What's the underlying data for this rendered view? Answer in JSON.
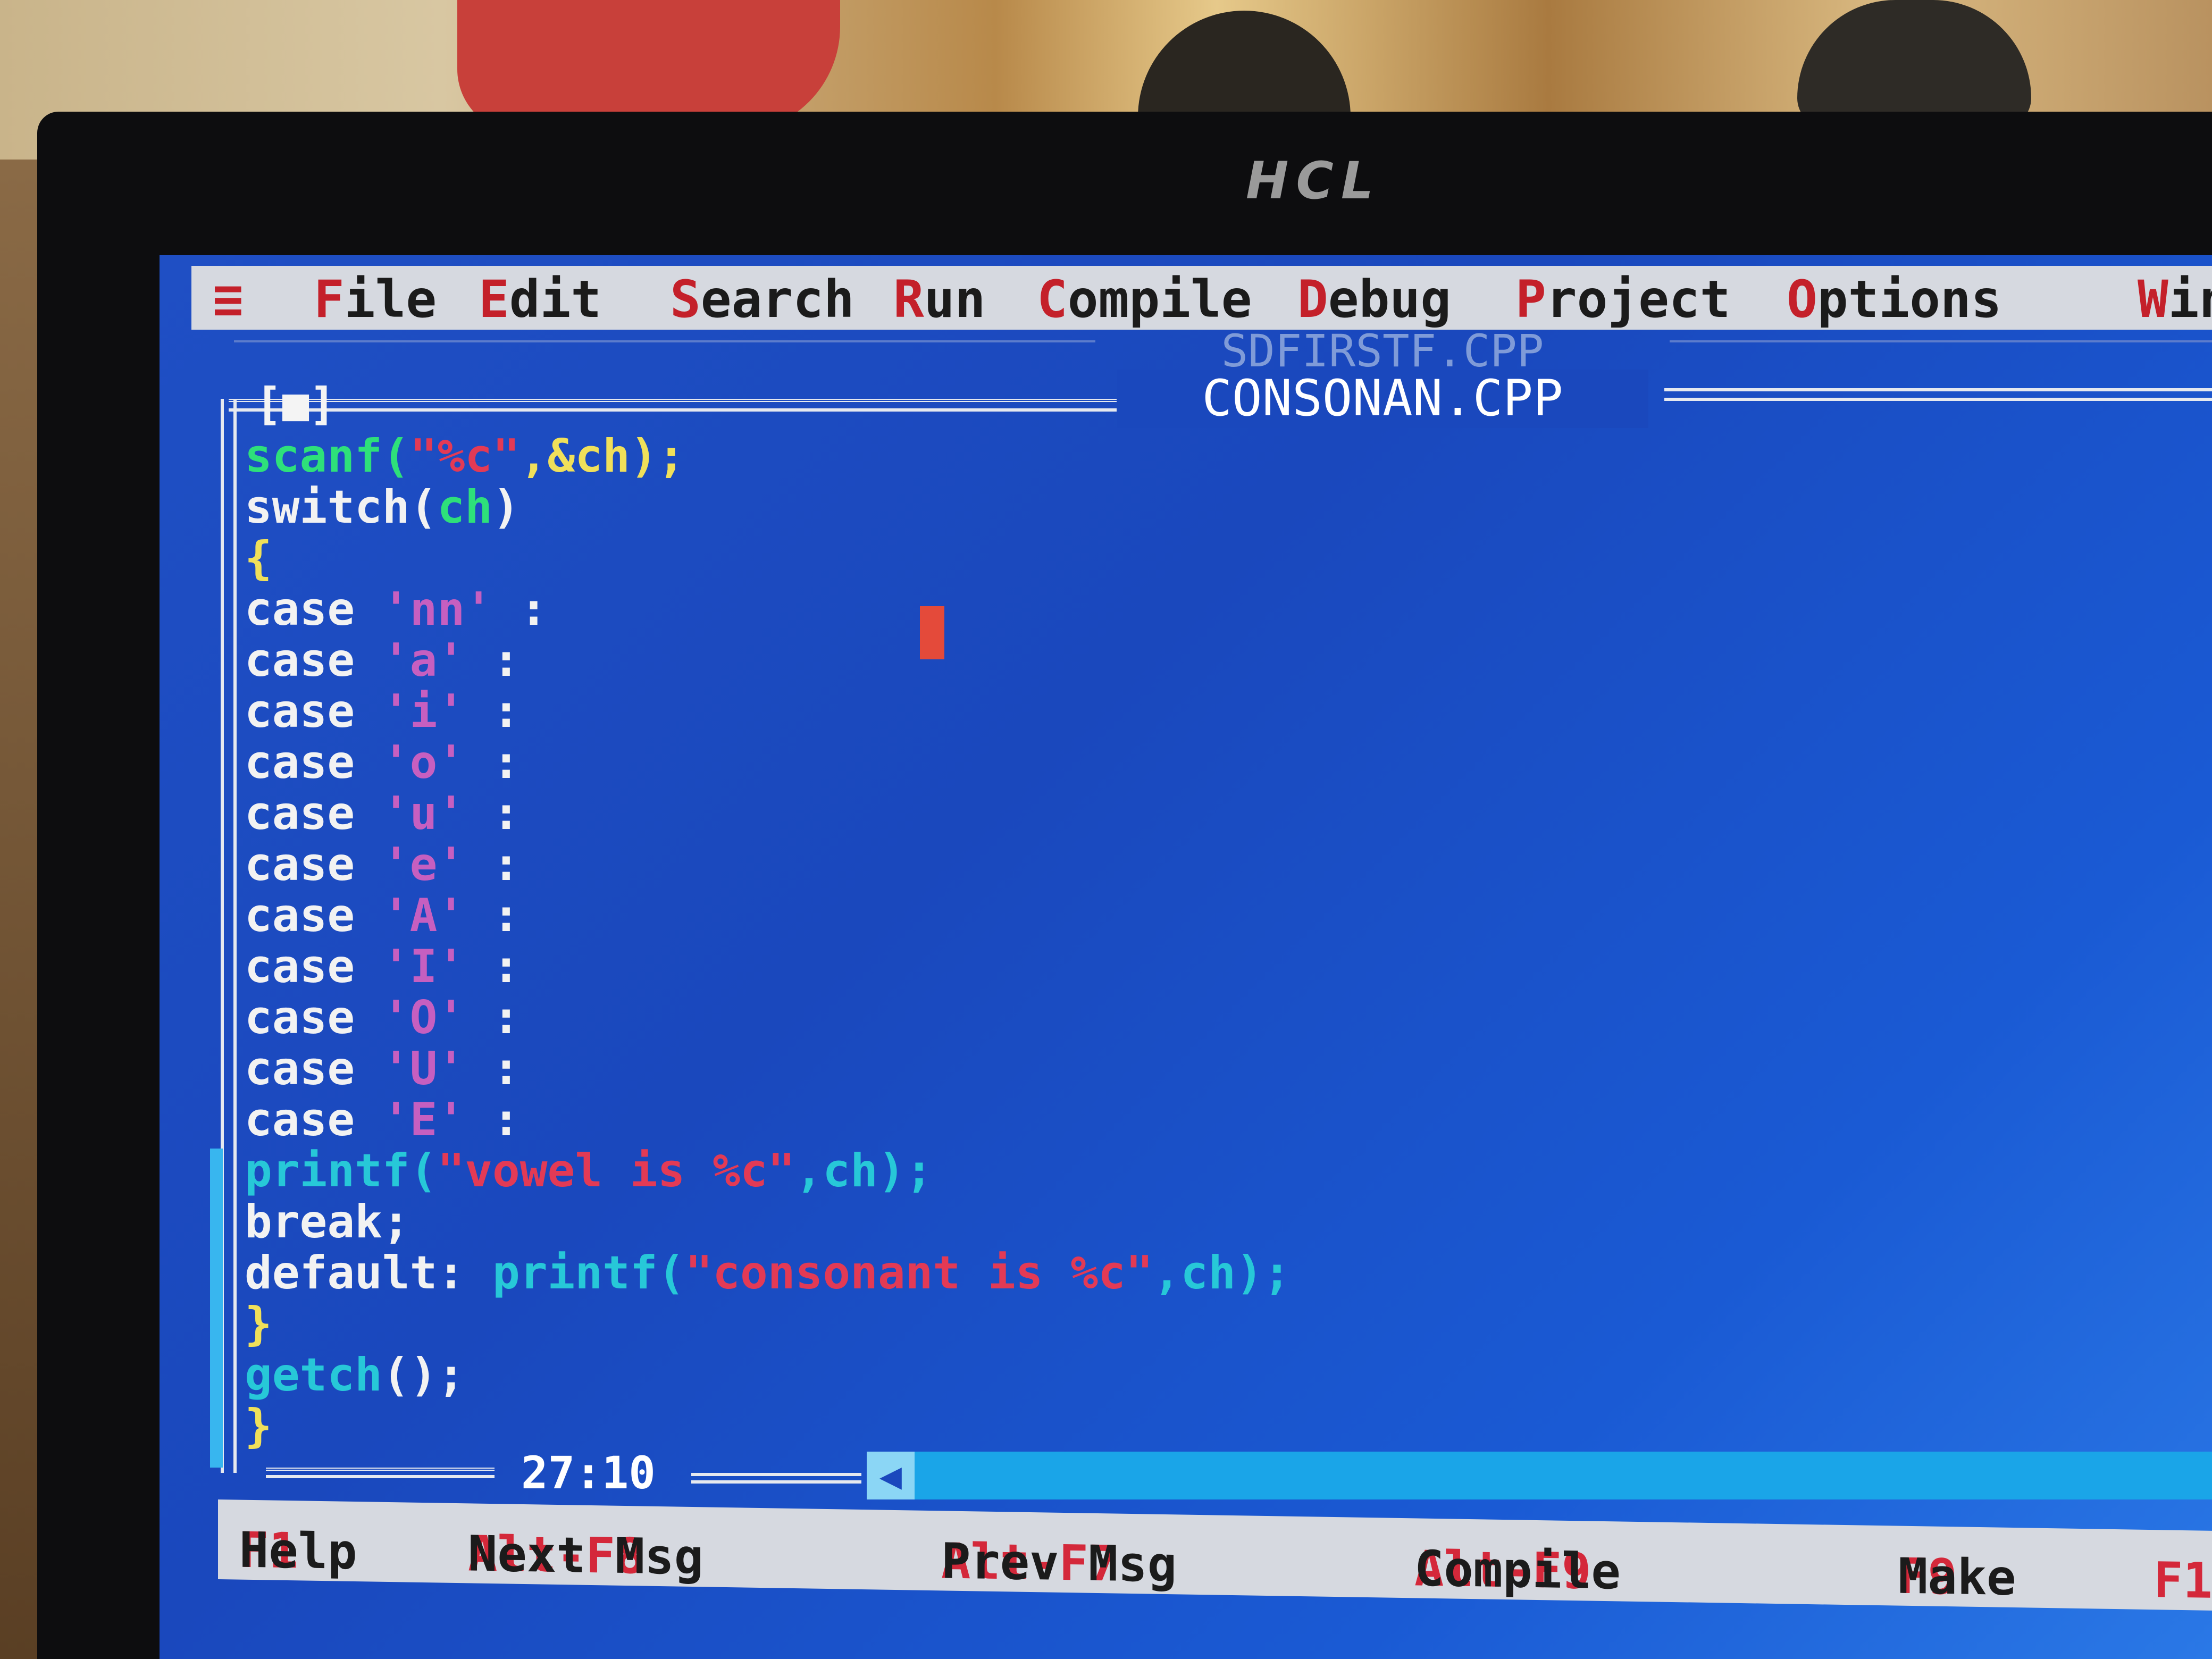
{
  "monitor": {
    "brand": "HCL"
  },
  "menu": {
    "system_icon": "≡",
    "items": [
      {
        "hotkey": "F",
        "rest": "ile"
      },
      {
        "hotkey": "E",
        "rest": "dit"
      },
      {
        "hotkey": "S",
        "rest": "earch"
      },
      {
        "hotkey": "R",
        "rest": "un"
      },
      {
        "hotkey": "C",
        "rest": "ompile"
      },
      {
        "hotkey": "D",
        "rest": "ebug"
      },
      {
        "hotkey": "P",
        "rest": "roject"
      },
      {
        "hotkey": "O",
        "rest": "ptions"
      },
      {
        "hotkey": "W",
        "rest": "in"
      }
    ]
  },
  "windows": {
    "background_file": "SDFIRSTF.CPP",
    "active_file": "CONSONAN.CPP",
    "close_box": "[■]"
  },
  "code": {
    "l1a": "scanf(",
    "l1b": "\"%c\"",
    "l1c": ",&ch);",
    "l2a": "switch(",
    "l2b": "ch",
    "l2c": ")",
    "l3": "{",
    "case_kw": "case",
    "cases": [
      "'nn'",
      "'a'",
      "'i'",
      "'o'",
      "'u'",
      "'e'",
      "'A'",
      "'I'",
      "'O'",
      "'U'",
      "'E'"
    ],
    "case_colon": " :",
    "p1a": "printf(",
    "p1b": "\"vowel is %c\"",
    "p1c": ",ch);",
    "brk": "break;",
    "defa": "default: ",
    "defb": "printf(",
    "defc": "\"consonant is %c\"",
    "defd": ",ch);",
    "close1": "}",
    "getcha": "getch",
    "getchb": "();",
    "close2": "}"
  },
  "status": {
    "cursor_position": "27:10"
  },
  "hints": [
    {
      "key": "F1",
      "label": "Help"
    },
    {
      "key": "Alt-F8",
      "label": "Next Msg"
    },
    {
      "key": "Alt-F7",
      "label": "Prev Msg"
    },
    {
      "key": "Alt-F9",
      "label": "Compile"
    },
    {
      "key": "F9",
      "label": "Make"
    },
    {
      "key": "F1",
      "label": ""
    }
  ],
  "colors": {
    "editor_bg": "#1a48bd",
    "menu_bg": "#d6d9e0",
    "hotkey": "#c4202a",
    "keyword": "#f2f2f2",
    "function": "#2ee07a",
    "string": "#e33a55",
    "char_literal": "#c65fc0"
  }
}
